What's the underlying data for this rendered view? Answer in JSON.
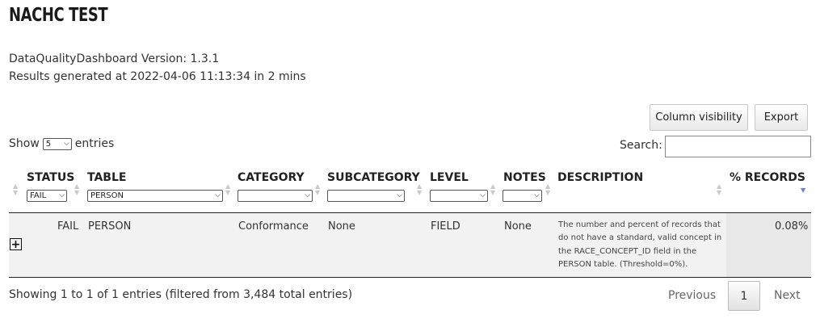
{
  "page": {
    "title": "NACHC TEST",
    "version_line": "DataQualityDashboard Version: 1.3.1",
    "generated_line": "Results generated at 2022-04-06 11:13:34 in 2 mins"
  },
  "toolbar": {
    "column_visibility_label": "Column visibility",
    "export_label": "Export"
  },
  "length": {
    "show_label": "Show",
    "value": "5",
    "entries_label": "entries"
  },
  "search": {
    "label": "Search:",
    "value": ""
  },
  "columns": {
    "status": "STATUS",
    "table": "TABLE",
    "category": "CATEGORY",
    "subcategory": "SUBCATEGORY",
    "level": "LEVEL",
    "notes": "NOTES",
    "description": "DESCRIPTION",
    "records": "% RECORDS"
  },
  "filters": {
    "status": "FAIL",
    "table": "PERSON",
    "category": "",
    "subcategory": "",
    "level": "",
    "notes": ""
  },
  "rows": [
    {
      "status": "FAIL",
      "table": "PERSON",
      "category": "Conformance",
      "subcategory": "None",
      "level": "FIELD",
      "notes": "None",
      "description": "The number and percent of records that do not have a standard, valid concept in the RACE_CONCEPT_ID field in the PERSON table. (Threshold=0%).",
      "records": "0.08%"
    }
  ],
  "footer": {
    "info": "Showing 1 to 1 of 1 entries (filtered from 3,484 total entries)",
    "previous_label": "Previous",
    "current_page": "1",
    "next_label": "Next"
  },
  "colors": {
    "header_line": "#222222",
    "row_background": "#f2f2f2",
    "sorted_column": "#e8e8e8",
    "sort_active": "#6a7fd0"
  }
}
